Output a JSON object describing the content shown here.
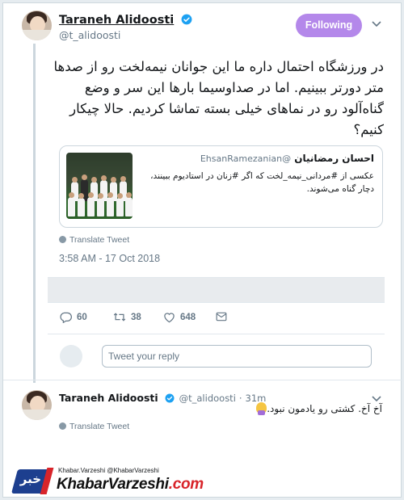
{
  "main_tweet": {
    "author_name": "Taraneh Alidoosti",
    "handle": "@t_alidoosti",
    "follow_label": "Following",
    "text": "در ورزشگاه احتمال داره ما این جوانان نیمه‌لخت رو از صدها متر دورتر ببینیم. اما در صداوسیما بارها این سر و وضع گناه‌آلود رو در نماهای خیلی بسته تماشا کردیم. حالا چیکار کنیم؟",
    "timestamp": "3:58 AM - 17 Oct 2018",
    "translate_label": "Translate Tweet",
    "reply_count": "60",
    "retweet_count": "38",
    "like_count": "648"
  },
  "quoted_tweet": {
    "author_name": "احسان رمضانیان",
    "handle": "@EhsanRamezanian",
    "text": "عکسی از #مردانی_نیمه_لخت که اگر #زنان در استادیوم ببینند، دچار گناه می‌شوند."
  },
  "reply_box": {
    "placeholder": "Tweet your reply"
  },
  "reply_tweet": {
    "author_name": "Taraneh Alidoosti",
    "handle": "@t_alidoosti",
    "age": "31m",
    "text": "آخ آخ. کشتی رو یادمون نبود.",
    "translate_label": "Translate Tweet"
  },
  "watermark": {
    "badge": "خبر",
    "small_line": "Khabar.Varzeshi @KhabarVarzeshi",
    "brand_main": "KhabarVarzeshi",
    "brand_suffix": ".com"
  },
  "colors": {
    "follow_button": "#b488ea",
    "verified": "#1da1f2",
    "secondary_text": "#657786",
    "watermark_blue": "#1d3f8f",
    "watermark_red": "#d8242a"
  },
  "icons": [
    "verified-badge-icon",
    "chevron-down-icon",
    "globe-icon",
    "reply-icon",
    "retweet-icon",
    "heart-icon",
    "message-icon"
  ]
}
